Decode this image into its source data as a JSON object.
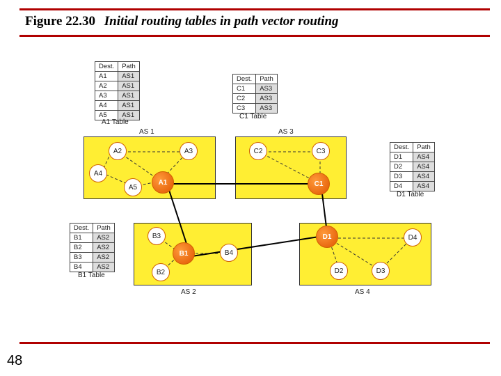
{
  "figure": {
    "label": "Figure 22.30",
    "caption": "Initial routing tables in path vector routing"
  },
  "page_number": "48",
  "headers": {
    "dest": "Dest.",
    "path": "Path"
  },
  "tables": {
    "a1": {
      "caption": "A1 Table",
      "rows": [
        [
          "A1",
          "AS1"
        ],
        [
          "A2",
          "AS1"
        ],
        [
          "A3",
          "AS1"
        ],
        [
          "A4",
          "AS1"
        ],
        [
          "A5",
          "AS1"
        ]
      ]
    },
    "c1": {
      "caption": "C1 Table",
      "rows": [
        [
          "C1",
          "AS3"
        ],
        [
          "C2",
          "AS3"
        ],
        [
          "C3",
          "AS3"
        ]
      ]
    },
    "d1": {
      "caption": "D1 Table",
      "rows": [
        [
          "D1",
          "AS4"
        ],
        [
          "D2",
          "AS4"
        ],
        [
          "D3",
          "AS4"
        ],
        [
          "D4",
          "AS4"
        ]
      ]
    },
    "b1": {
      "caption": "B1 Table",
      "rows": [
        [
          "B1",
          "AS2"
        ],
        [
          "B2",
          "AS2"
        ],
        [
          "B3",
          "AS2"
        ],
        [
          "B4",
          "AS2"
        ]
      ]
    }
  },
  "as": {
    "as1": {
      "label": "AS 1",
      "nodes": [
        "A1",
        "A2",
        "A3",
        "A4",
        "A5"
      ]
    },
    "as2": {
      "label": "AS 2",
      "nodes": [
        "B1",
        "B2",
        "B3",
        "B4"
      ]
    },
    "as3": {
      "label": "AS 3",
      "nodes": [
        "C1",
        "C2",
        "C3"
      ]
    },
    "as4": {
      "label": "AS 4",
      "nodes": [
        "D1",
        "D2",
        "D3",
        "D4"
      ]
    }
  }
}
